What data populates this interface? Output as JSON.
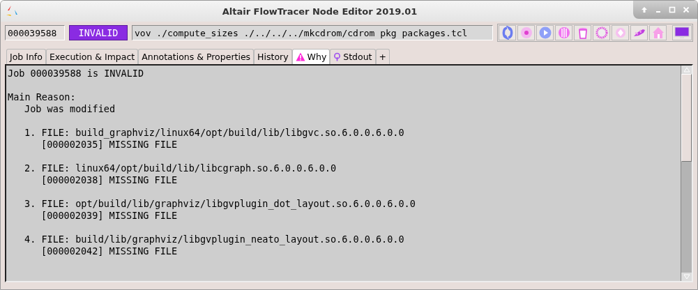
{
  "window": {
    "title": "Altair FlowTracer Node Editor 2019.01"
  },
  "job_id": "000039588",
  "status": "INVALID",
  "command": "vov ./compute_sizes ./../../../mkcdrom/cdrom pkg packages.tcl",
  "toolbar": [
    {
      "kind": "refresh"
    },
    {
      "kind": "disc"
    },
    {
      "kind": "play"
    },
    {
      "kind": "stripes"
    },
    {
      "kind": "trash"
    },
    {
      "kind": "ring"
    },
    {
      "kind": "diamond"
    },
    {
      "kind": "plane"
    },
    {
      "kind": "home"
    },
    {
      "kind": "monitor"
    }
  ],
  "tabs": [
    {
      "label": "Job Info",
      "selected": false
    },
    {
      "label": "Execution & Impact",
      "selected": false
    },
    {
      "label": "Annotations & Properties",
      "selected": false
    },
    {
      "label": "History",
      "selected": false
    },
    {
      "label": "Why",
      "selected": true,
      "kind": "warning"
    },
    {
      "label": "Stdout",
      "selected": false,
      "kind": "pin"
    },
    {
      "label": "+",
      "selected": false
    }
  ],
  "report": {
    "heading": "Job 000039588 is INVALID",
    "reason_label": "Main Reason:",
    "reason": "Job was modified",
    "files": [
      {
        "line": "1. FILE: build_graphviz/linux64/opt/build/lib/libgvc.so.6.0.0.6.0.0",
        "detail": "[000002035] MISSING FILE"
      },
      {
        "line": "2. FILE: linux64/opt/build/lib/libcgraph.so.6.0.0.6.0.0",
        "detail": "[000002038] MISSING FILE"
      },
      {
        "line": "3. FILE: opt/build/lib/graphviz/libgvplugin_dot_layout.so.6.0.0.6.0.0",
        "detail": "[000002039] MISSING FILE"
      },
      {
        "line": "4. FILE: build/lib/graphviz/libgvplugin_neato_layout.so.6.0.0.6.0.0",
        "detail": "[000002042] MISSING FILE"
      }
    ]
  }
}
